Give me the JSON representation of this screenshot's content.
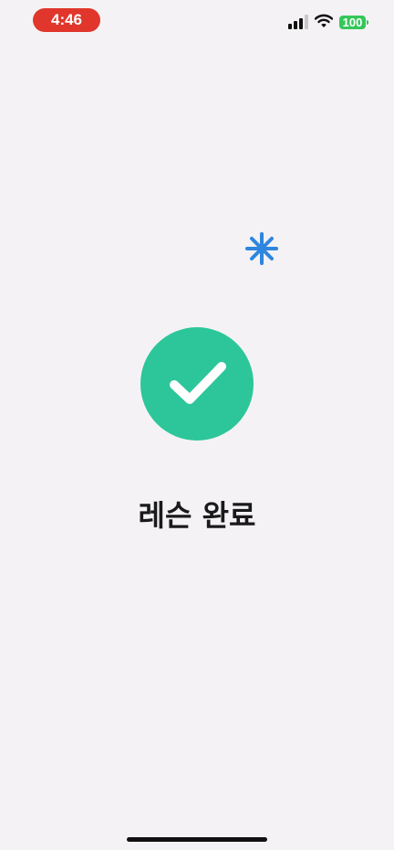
{
  "status_bar": {
    "time": "4:46",
    "battery_level": "100",
    "signal_icon": "cellular-signal-icon",
    "wifi_icon": "wifi-icon",
    "time_pill_color": "#e0362b",
    "battery_color": "#34c759"
  },
  "decoration": {
    "sparkle_icon": "sparkle-icon",
    "sparkle_color": "#2e86de"
  },
  "result": {
    "icon": "checkmark-icon",
    "circle_color": "#2cc69a",
    "title": "레슨 완료"
  }
}
